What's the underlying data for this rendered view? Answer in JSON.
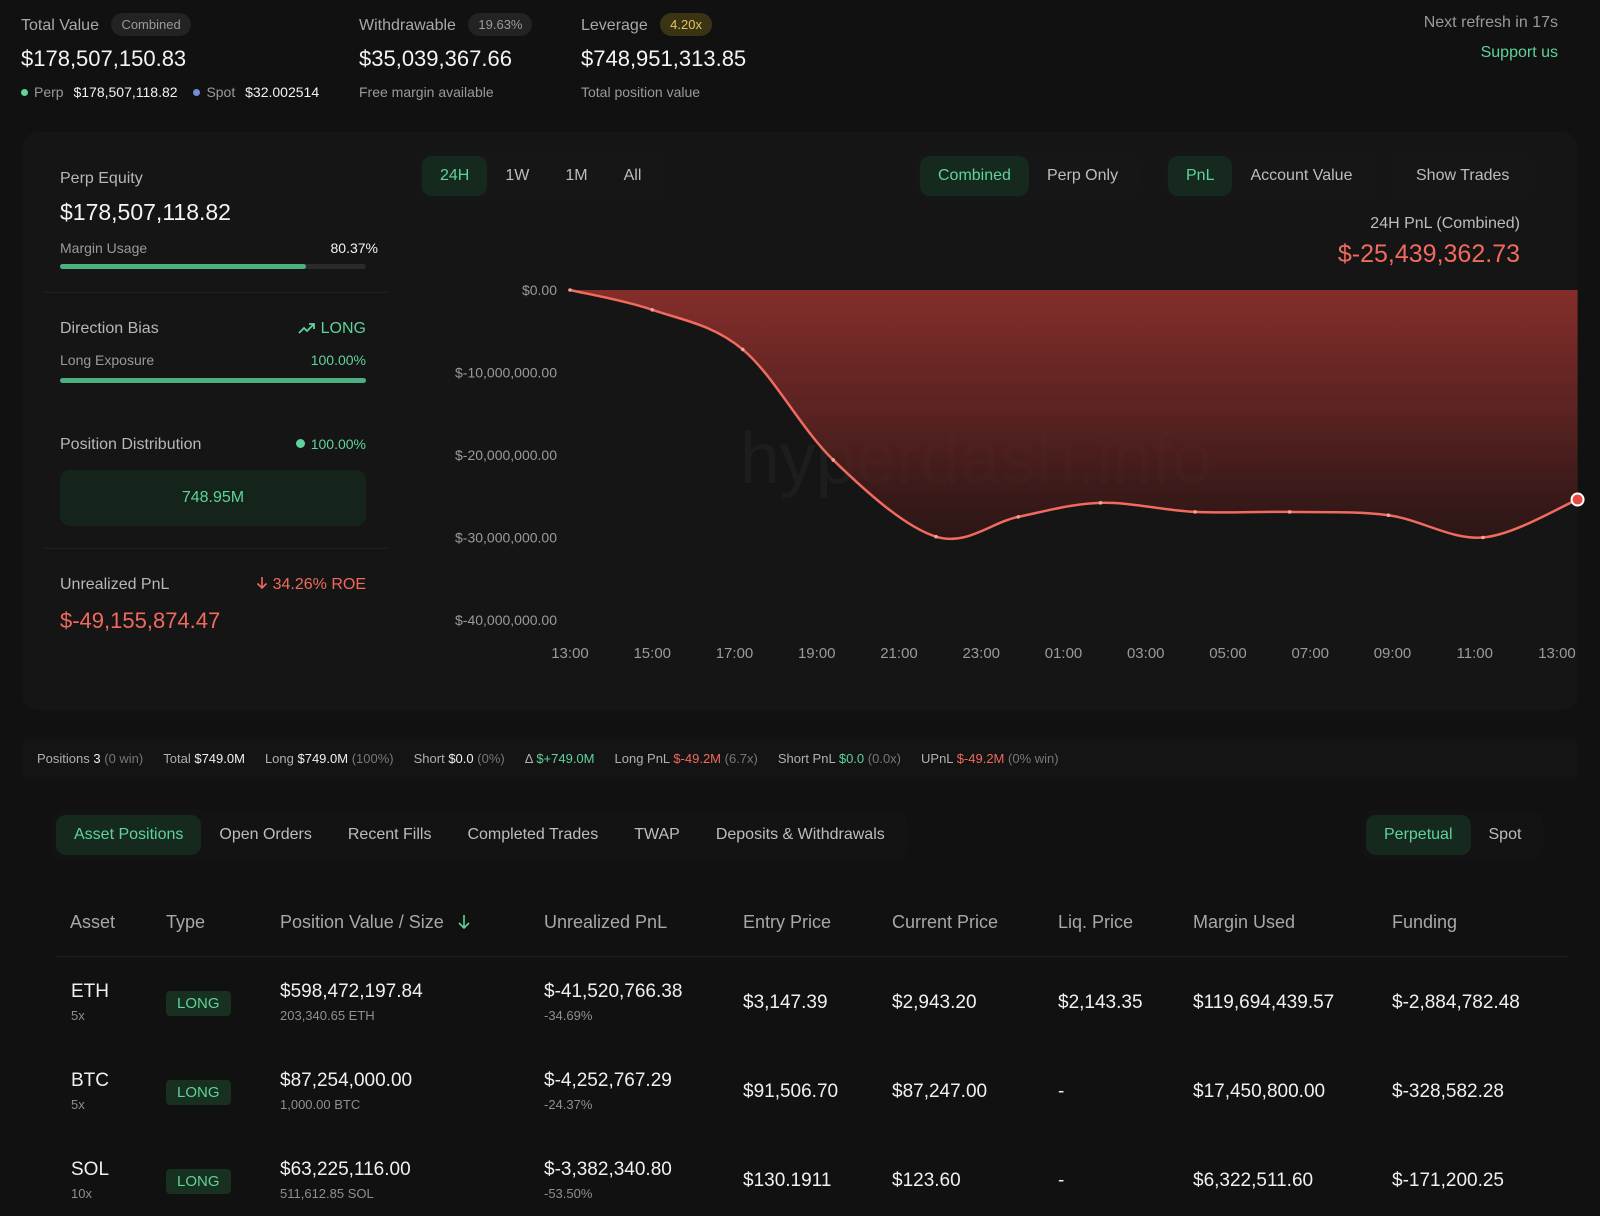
{
  "header": {
    "total_value": {
      "label": "Total Value",
      "badge": "Combined",
      "value": "$178,507,150.83",
      "perp_label": "Perp",
      "perp_value": "$178,507,118.82",
      "spot_label": "Spot",
      "spot_value": "$32.002514"
    },
    "withdrawable": {
      "label": "Withdrawable",
      "badge": "19.63%",
      "value": "$35,039,367.66",
      "sub": "Free margin available"
    },
    "leverage": {
      "label": "Leverage",
      "badge": "4.20x",
      "value": "$748,951,313.85",
      "sub": "Total position value"
    },
    "refresh": "Next refresh in 17s",
    "support": "Support us"
  },
  "sidebar": {
    "perp_equity": {
      "label": "Perp Equity",
      "value": "$178,507,118.82",
      "margin_label": "Margin Usage",
      "margin_value": "80.37%",
      "margin_fraction": 0.8037
    },
    "direction_bias": {
      "label": "Direction Bias",
      "value": "LONG",
      "exposure_label": "Long Exposure",
      "exposure_value": "100.00%",
      "exposure_fraction": 1.0
    },
    "position_distribution": {
      "label": "Position Distribution",
      "value": "100.00%",
      "box_value": "748.95M"
    },
    "unrealized_pnl": {
      "label": "Unrealized PnL",
      "roe": "34.26% ROE",
      "value": "$-49,155,874.47"
    }
  },
  "chart_tabs": {
    "range": [
      "24H",
      "1W",
      "1M",
      "All"
    ],
    "mode": [
      "Combined",
      "Perp Only"
    ],
    "metric": [
      "PnL",
      "Account Value"
    ],
    "show_trades": "Show Trades"
  },
  "chart_summary": {
    "label": "24H PnL (Combined)",
    "value": "$-25,439,362.73"
  },
  "chart_data": {
    "type": "area",
    "title": "",
    "xlabel": "",
    "ylabel": "",
    "ylim": [
      -40000000,
      0
    ],
    "y_ticks": [
      "$0.00",
      "$-10,000,000.00",
      "$-20,000,000.00",
      "$-30,000,000.00",
      "$-40,000,000.00"
    ],
    "y_tick_values": [
      0,
      -10000000,
      -20000000,
      -30000000,
      -40000000
    ],
    "x_ticks": [
      "13:00",
      "15:00",
      "17:00",
      "19:00",
      "21:00",
      "23:00",
      "01:00",
      "03:00",
      "05:00",
      "07:00",
      "09:00",
      "11:00",
      "13:00"
    ],
    "x": [
      0,
      2,
      4.2,
      6.4,
      8.9,
      10.9,
      12.9,
      15.2,
      17.5,
      19.9,
      22.2,
      24.5
    ],
    "y": [
      0,
      -2400000,
      -7200000,
      -20600000,
      -29900000,
      -27500000,
      -25800000,
      -26900000,
      -26900000,
      -27300000,
      -30000000,
      -25400000
    ],
    "color": "#f06a5e",
    "fill": "#8a2f2c",
    "watermark": "hyperdash.info"
  },
  "strip": {
    "positions_label": "Positions",
    "positions_value": "3",
    "positions_win": "(0 win)",
    "total_label": "Total",
    "total_value": "$749.0M",
    "long_label": "Long",
    "long_value": "$749.0M",
    "long_pct": "(100%)",
    "short_label": "Short",
    "short_value": "$0.0",
    "short_pct": "(0%)",
    "delta_label": "Δ",
    "delta_value": "$+749.0M",
    "long_pnl_label": "Long PnL",
    "long_pnl_value": "$-49.2M",
    "long_pnl_x": "(6.7x)",
    "short_pnl_label": "Short PnL",
    "short_pnl_value": "$0.0",
    "short_pnl_x": "(0.0x)",
    "upnl_label": "UPnL",
    "upnl_value": "$-49.2M",
    "upnl_win": "(0% win)"
  },
  "bottom_tabs": [
    "Asset Positions",
    "Open Orders",
    "Recent Fills",
    "Completed Trades",
    "TWAP",
    "Deposits & Withdrawals"
  ],
  "market_tabs": [
    "Perpetual",
    "Spot"
  ],
  "table": {
    "headers": [
      "Asset",
      "Type",
      "Position Value / Size",
      "Unrealized PnL",
      "Entry Price",
      "Current Price",
      "Liq. Price",
      "Margin Used",
      "Funding"
    ],
    "rows": [
      {
        "asset": "ETH",
        "lev": "5x",
        "type": "LONG",
        "value": "$598,472,197.84",
        "size": "203,340.65 ETH",
        "pnl": "$-41,520,766.38",
        "pnl_pct": "-34.69%",
        "entry": "$3,147.39",
        "current": "$2,943.20",
        "liq": "$2,143.35",
        "margin": "$119,694,439.57",
        "funding": "$-2,884,782.48"
      },
      {
        "asset": "BTC",
        "lev": "5x",
        "type": "LONG",
        "value": "$87,254,000.00",
        "size": "1,000.00 BTC",
        "pnl": "$-4,252,767.29",
        "pnl_pct": "-24.37%",
        "entry": "$91,506.70",
        "current": "$87,247.00",
        "liq": "-",
        "margin": "$17,450,800.00",
        "funding": "$-328,582.28"
      },
      {
        "asset": "SOL",
        "lev": "10x",
        "type": "LONG",
        "value": "$63,225,116.00",
        "size": "511,612.85 SOL",
        "pnl": "$-3,382,340.80",
        "pnl_pct": "-53.50%",
        "entry": "$130.1911",
        "current": "$123.60",
        "liq": "-",
        "margin": "$6,322,511.60",
        "funding": "$-171,200.25"
      }
    ]
  }
}
